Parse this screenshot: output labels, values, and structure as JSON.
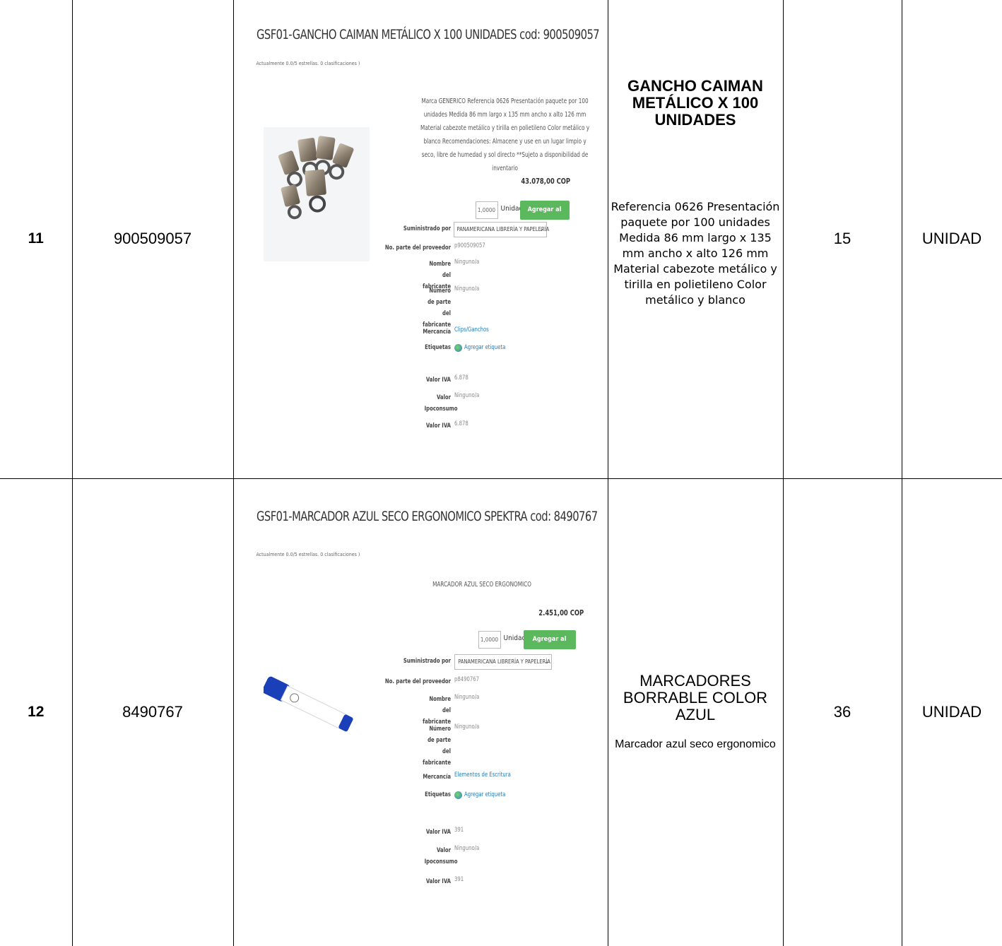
{
  "rows": [
    {
      "num": "11",
      "code": "900509057",
      "qty": "15",
      "unit": "UNIDAD",
      "desc_title": "GANCHO CAIMAN METÁLICO X 100 UNIDADES",
      "desc_text": "Referencia 0626 Presentación paquete por 100 unidades Medida 86 mm largo x 135 mm ancho x alto 126 mm Material cabezote metálico y tirilla en polietileno Color metálico y blanco",
      "shot": {
        "title": "GSF01-GANCHO CAIMAN METÁLICO X 100 UNIDADES cod: 900509057",
        "rating": "Actualmente 0.0/5 estrellas. 0 clasificaciones )",
        "description": "Marca GENERICO Referencia 0626 Presentación paquete por 100 unidades Medida 86 mm largo x 135 mm ancho x alto 126 mm Material cabezote metálico y tirilla en polietileno Color metálico y blanco Recomendaciones: Almacene y use en un lugar limpio y seco, libre de humedad y sol directo **Sujeto a disponibilidad de inventario",
        "price": "43.078,00 COP",
        "qty": "1,0000",
        "unit": "Unidad",
        "cart": "Agregar al carrito",
        "supplied_label": "Suministrado por",
        "supplier": "PANAMERICANA LIBRERÍA Y PAPELERÍA",
        "part_label": "No. parte del proveedor",
        "part": "p900509057",
        "maker_label": "Nombre del fabricante",
        "maker": "Ninguno/a",
        "maker_part_label": "Número de parte del fabricante",
        "maker_part": "Ninguno/a",
        "merch_label": "Mercancía",
        "merch": "Clips/Ganchos",
        "tags_label": "Etiquetas",
        "tags": "Agregar etiqueta",
        "iva_label": "Valor IVA",
        "iva": "6.878",
        "ipo_label": "Valor Ipoconsumo",
        "ipo": "Ninguno/a",
        "iva2_label": "Valor IVA",
        "iva2": "6.878"
      }
    },
    {
      "num": "12",
      "code": "8490767",
      "qty": "36",
      "unit": "UNIDAD",
      "desc_title": "MARCADORES BORRABLE COLOR AZUL",
      "desc_text": "Marcador azul seco ergonomico",
      "shot": {
        "title": "GSF01-MARCADOR AZUL SECO ERGONOMICO SPEKTRA cod: 8490767",
        "rating": "Actualmente 0.0/5 estrellas. 0 clasificaciones )",
        "description": "MARCADOR AZUL SECO ERGONOMICO",
        "price": "2.451,00 COP",
        "qty": "1,0000",
        "unit": "Unidad",
        "cart": "Agregar al carrito",
        "supplied_label": "Suministrado por",
        "supplier": "PANAMERICANA LIBRERÍA Y PAPELERÍA",
        "part_label": "No. parte del proveedor",
        "part": "p8490767",
        "maker_label": "Nombre del fabricante",
        "maker": "Ninguno/a",
        "maker_part_label": "Número de parte del fabricante",
        "maker_part": "Ninguno/a",
        "merch_label": "Mercancía",
        "merch": "Elementos de Escritura",
        "tags_label": "Etiquetas",
        "tags": "Agregar etiqueta",
        "iva_label": "Valor IVA",
        "iva": "391",
        "ipo_label": "Valor Ipoconsumo",
        "ipo": "Ninguno/a",
        "iva2_label": "Valor IVA",
        "iva2": "391"
      }
    }
  ]
}
